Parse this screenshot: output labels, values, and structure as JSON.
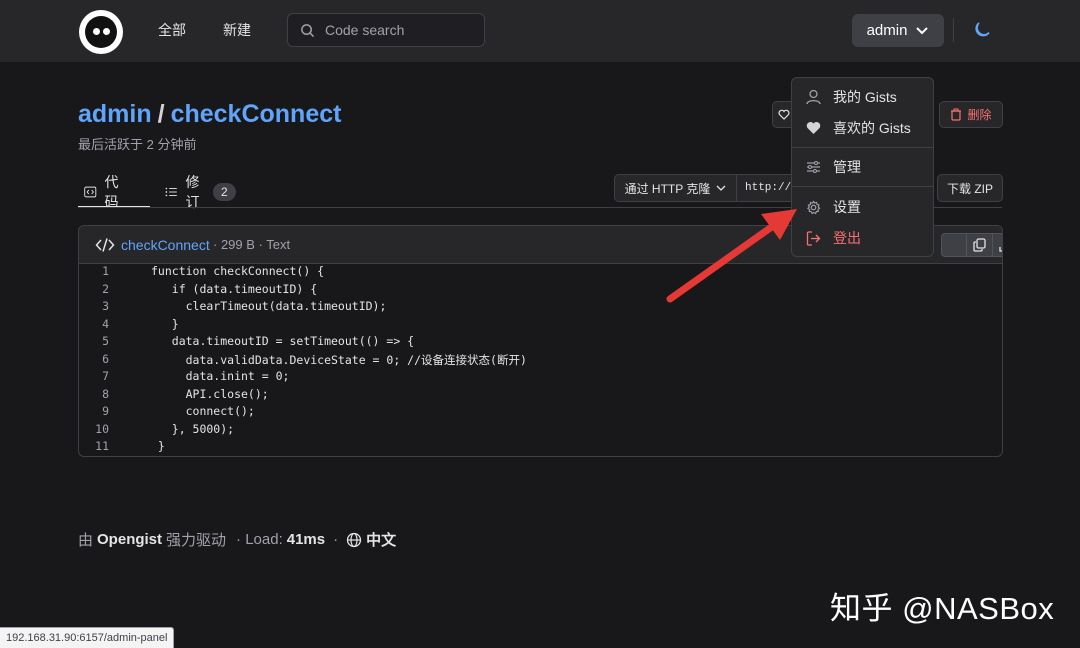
{
  "header": {
    "nav_all": "全部",
    "nav_new": "新建",
    "search_placeholder": "Code search",
    "user_label": "admin"
  },
  "gist": {
    "owner": "admin",
    "separator": "/",
    "name": "checkConnect",
    "last_active": "最后活跃于 2 分钟前",
    "delete_label": "删除"
  },
  "tabs": [
    {
      "label": "代码"
    },
    {
      "label": "修订",
      "count": "2"
    }
  ],
  "clone": {
    "select_label": "通过 HTTP 克隆",
    "url_value": "http://",
    "download_label": "下载 ZIP"
  },
  "file": {
    "name": "checkConnect",
    "meta": "· 299 B · Text"
  },
  "code_lines": [
    {
      "n": "1",
      "text": "function checkConnect() {"
    },
    {
      "n": "2",
      "text": "   if (data.timeoutID) {"
    },
    {
      "n": "3",
      "text": "     clearTimeout(data.timeoutID);"
    },
    {
      "n": "4",
      "text": "   }"
    },
    {
      "n": "5",
      "text": "   data.timeoutID = setTimeout(() => {"
    },
    {
      "n": "6",
      "text": "     data.validData.DeviceState = 0; //设备连接状态(断开)"
    },
    {
      "n": "7",
      "text": "     data.inint = 0;"
    },
    {
      "n": "8",
      "text": "     API.close();"
    },
    {
      "n": "9",
      "text": "     connect();"
    },
    {
      "n": "10",
      "text": "   }, 5000);"
    },
    {
      "n": "11",
      "text": " }"
    }
  ],
  "footer": {
    "by": "由",
    "brand": "Opengist",
    "powered": "强力驱动",
    "load_prefix": "· Load:",
    "load_value": "41ms",
    "dot": "·",
    "language": "中文"
  },
  "user_menu": [
    {
      "label": "我的 Gists",
      "icon": "user-icon"
    },
    {
      "label": "喜欢的 Gists",
      "icon": "heart-icon"
    },
    {
      "label": "管理",
      "icon": "sliders-icon"
    },
    {
      "label": "设置",
      "icon": "gear-icon"
    },
    {
      "label": "登出",
      "icon": "logout-icon",
      "color": "#f87171"
    }
  ],
  "status_bar": "192.168.31.90:6157/admin-panel",
  "watermark": "知乎 @NASBox",
  "colors": {
    "accent": "#60a5fa",
    "danger": "#f87171",
    "arrow": "#e53935"
  }
}
